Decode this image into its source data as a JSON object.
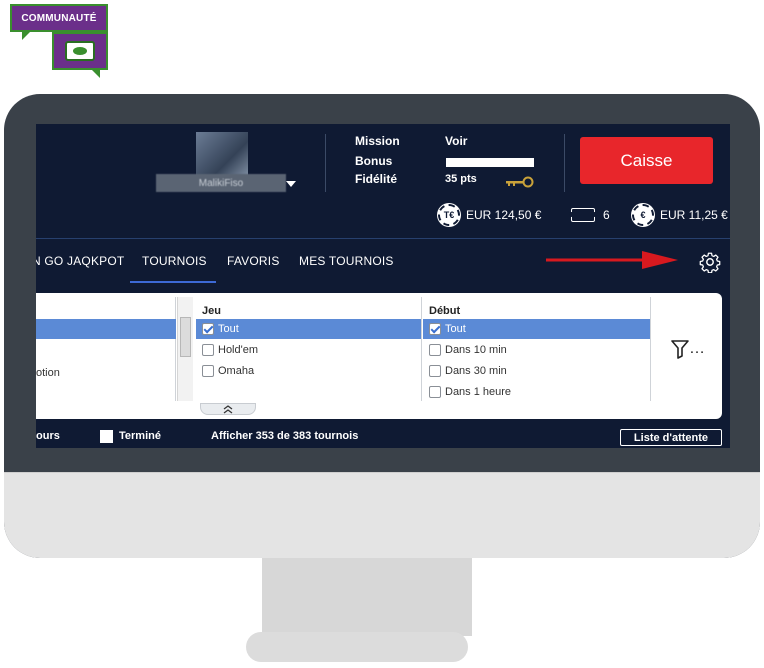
{
  "badge": {
    "text": "COMMUNAUTÉ"
  },
  "header": {
    "username": "MalikiFiso",
    "mission_label": "Mission",
    "bonus_label": "Bonus",
    "fidelite_label": "Fidélité",
    "voir_label": "Voir",
    "points": "35 pts",
    "loyalty_progress": 1.0,
    "cashier_button": "Caisse",
    "wallet": [
      {
        "icon": "tournament-euro-chip-icon",
        "symbol": "T€",
        "amount": "EUR 124,50 €"
      },
      {
        "icon": "ticket-icon",
        "amount": "6"
      },
      {
        "icon": "euro-chip-icon",
        "symbol": "€",
        "amount": "EUR 11,25 €"
      }
    ]
  },
  "nav": {
    "tabs": [
      "N GO JAQKPOT",
      "TOURNOIS",
      "FAVORIS",
      "MES TOURNOIS"
    ],
    "active_tab": "TOURNOIS"
  },
  "filters": {
    "left_partial_text": "otion",
    "jeu": {
      "header": "Jeu",
      "options": [
        {
          "label": "Tout",
          "checked": true,
          "selected": true
        },
        {
          "label": "Hold'em",
          "checked": false,
          "selected": false
        },
        {
          "label": "Omaha",
          "checked": false,
          "selected": false
        }
      ]
    },
    "debut": {
      "header": "Début",
      "options": [
        {
          "label": "Tout",
          "checked": true,
          "selected": true
        },
        {
          "label": "Dans 10 min",
          "checked": false,
          "selected": false
        },
        {
          "label": "Dans 30 min",
          "checked": false,
          "selected": false
        },
        {
          "label": "Dans 1 heure",
          "checked": false,
          "selected": false
        }
      ]
    },
    "filter_label": "…"
  },
  "status": {
    "partial_left": "ours",
    "termine_label": "Terminé",
    "count_text": "Afficher 353 de 383 tournois",
    "waitlist_button": "Liste d'attente"
  },
  "colors": {
    "screen_bg": "#0f1a33",
    "cashier": "#e8262b",
    "selection": "#5b8ad6",
    "annotation_arrow": "#d7191f",
    "badge_purple": "#6b2f8a",
    "badge_green": "#3a8f2e"
  }
}
